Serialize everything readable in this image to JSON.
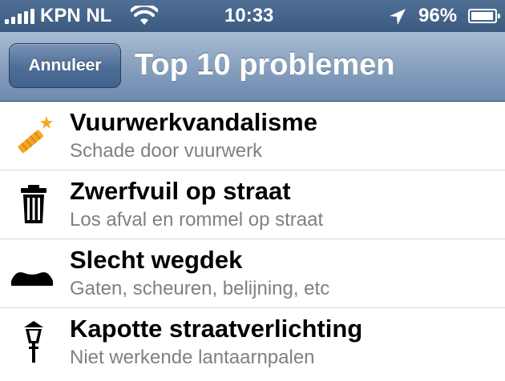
{
  "status_bar": {
    "carrier": "KPN NL",
    "time": "10:33",
    "battery": "96%",
    "battery_level": 0.96
  },
  "nav": {
    "cancel_label": "Annuleer",
    "title": "Top 10 problemen"
  },
  "items": [
    {
      "title": "Vuurwerkvandalisme",
      "subtitle": "Schade door vuurwerk",
      "icon": "firework-icon"
    },
    {
      "title": "Zwerfvuil op straat",
      "subtitle": "Los afval en rommel op straat",
      "icon": "trash-icon"
    },
    {
      "title": "Slecht wegdek",
      "subtitle": "Gaten, scheuren, belijning, etc",
      "icon": "road-bump-icon"
    },
    {
      "title": "Kapotte straatverlichting",
      "subtitle": "Niet werkende lantaarnpalen",
      "icon": "street-lamp-icon"
    }
  ],
  "colors": {
    "nav_bar": "#8aa3c0",
    "status_bar": "#3c5a80",
    "accent_firework": "#f5a623"
  }
}
